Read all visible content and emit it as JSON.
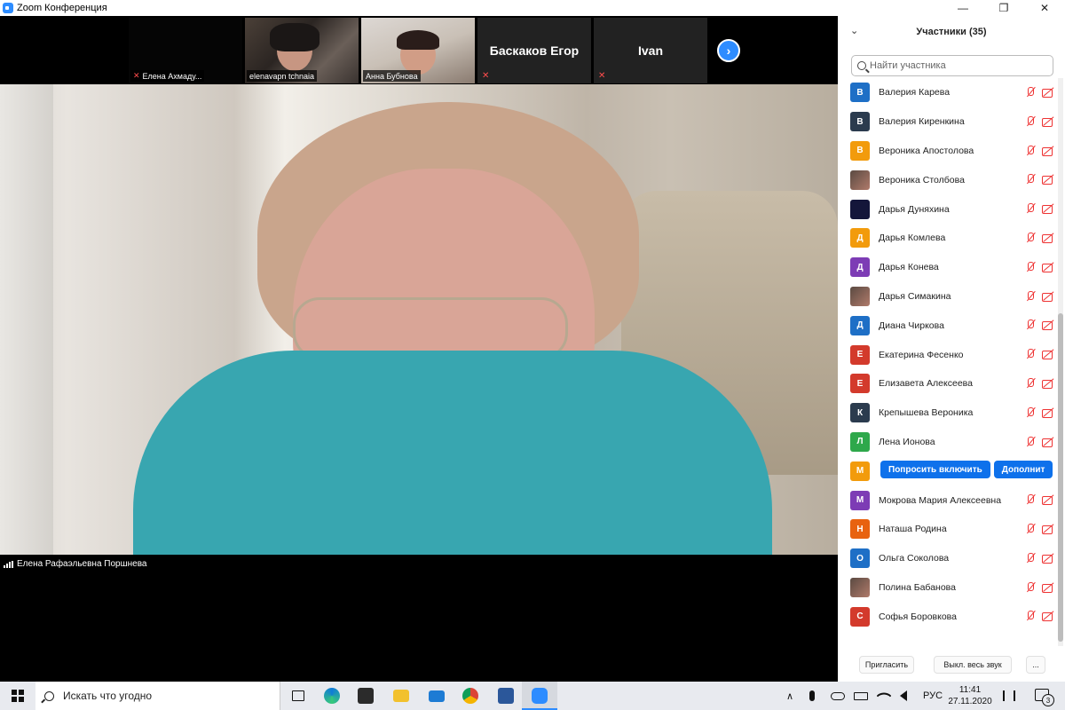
{
  "window": {
    "title": "Zoom Конференция",
    "minimize_glyph": "—",
    "restore_glyph": "❐",
    "close_glyph": "✕"
  },
  "thumbnails": [
    {
      "label": "Елена Ахмаду...",
      "muted": true
    },
    {
      "label": "elenavapn tchnaia",
      "muted": false
    },
    {
      "label": "Анна Бубнова",
      "muted": false
    },
    {
      "label": "Баскаков Егор",
      "muted": true
    },
    {
      "label": "Ivan",
      "muted": true
    }
  ],
  "next_glyph": "›",
  "active_speaker": "Елена Рафаэльевна Поршнева",
  "panel": {
    "title": "Участники (35)",
    "search_placeholder": "Найти участника",
    "participants": [
      {
        "initial": "В",
        "name": "Валерия Карева",
        "color": "#1e6fc6"
      },
      {
        "initial": "В",
        "name": "Валерия Киренкина",
        "color": "#2b3b4e"
      },
      {
        "initial": "В",
        "name": "Вероника Апостолова",
        "color": "#f29b0c"
      },
      {
        "initial": "",
        "name": "Вероника Столбова",
        "color": "photo"
      },
      {
        "initial": "",
        "name": "Дарья Дуняхина",
        "color": "#14163a"
      },
      {
        "initial": "Д",
        "name": "Дарья Комлева",
        "color": "#f29b0c"
      },
      {
        "initial": "Д",
        "name": "Дарья Конева",
        "color": "#7d3cb5"
      },
      {
        "initial": "",
        "name": "Дарья Симакина",
        "color": "photo"
      },
      {
        "initial": "Д",
        "name": "Диана Чиркова",
        "color": "#1e6fc6"
      },
      {
        "initial": "Е",
        "name": "Екатерина Фесенко",
        "color": "#d33a2c"
      },
      {
        "initial": "Е",
        "name": "Елизавета Алексеева",
        "color": "#d33a2c"
      },
      {
        "initial": "К",
        "name": "Крепышева Вероника",
        "color": "#2b3b4e"
      },
      {
        "initial": "Л",
        "name": "Лена Ионова",
        "color": "#2ea84b"
      },
      {
        "initial": "М",
        "name": "",
        "color": "#f29b0c",
        "hover": true
      },
      {
        "initial": "М",
        "name": "Мокрова Мария Алексеевна",
        "color": "#7d3cb5"
      },
      {
        "initial": "Н",
        "name": "Наташа Родина",
        "color": "#e8620f"
      },
      {
        "initial": "О",
        "name": "Ольга Соколова",
        "color": "#1e6fc6"
      },
      {
        "initial": "",
        "name": "Полина Бабанова",
        "color": "photo"
      },
      {
        "initial": "С",
        "name": "Софья Боровкова",
        "color": "#d33a2c"
      }
    ],
    "hover_actions": {
      "ask_unmute": "Попросить включить",
      "more": "Дополнит"
    },
    "footer": {
      "invite": "Пригласить",
      "mute_all": "Выкл. весь звук",
      "more": "..."
    }
  },
  "taskbar": {
    "search_placeholder": "Искать что угодно",
    "language": "РУС",
    "time": "11:41",
    "date": "27.11.2020",
    "notifications": "3",
    "tray_up_glyph": "∧"
  },
  "colors": {
    "accent": "#2d8cff",
    "muted_red": "#e33333"
  }
}
